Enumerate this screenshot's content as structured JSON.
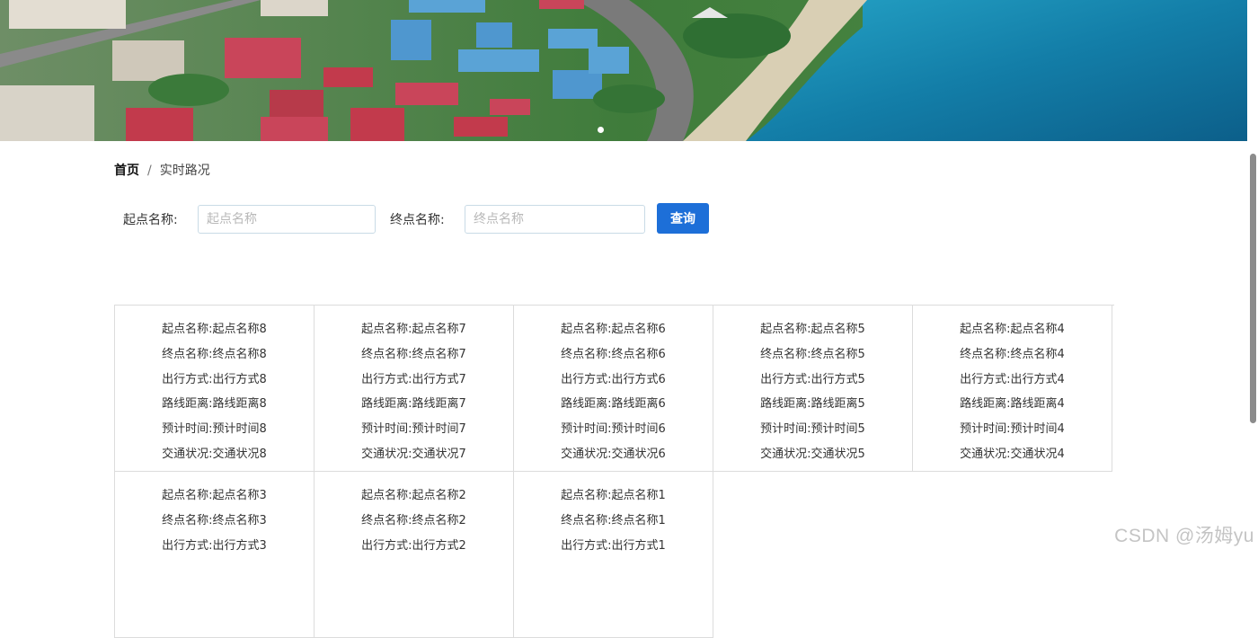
{
  "banner": {
    "image": "coastal-city-aerial",
    "dots": 1
  },
  "breadcrumb": {
    "home": "首页",
    "separator": "/",
    "current": "实时路况"
  },
  "search": {
    "start_label": "起点名称:",
    "start_placeholder": "起点名称",
    "start_value": "",
    "end_label": "终点名称:",
    "end_placeholder": "终点名称",
    "end_value": "",
    "query_label": "查询"
  },
  "cards": [
    {
      "lines": [
        "起点名称:起点名称8",
        "终点名称:终点名称8",
        "出行方式:出行方式8",
        "路线距离:路线距离8",
        "预计时间:预计时间8",
        "交通状况:交通状况8"
      ]
    },
    {
      "lines": [
        "起点名称:起点名称7",
        "终点名称:终点名称7",
        "出行方式:出行方式7",
        "路线距离:路线距离7",
        "预计时间:预计时间7",
        "交通状况:交通状况7"
      ]
    },
    {
      "lines": [
        "起点名称:起点名称6",
        "终点名称:终点名称6",
        "出行方式:出行方式6",
        "路线距离:路线距离6",
        "预计时间:预计时间6",
        "交通状况:交通状况6"
      ]
    },
    {
      "lines": [
        "起点名称:起点名称5",
        "终点名称:终点名称5",
        "出行方式:出行方式5",
        "路线距离:路线距离5",
        "预计时间:预计时间5",
        "交通状况:交通状况5"
      ]
    },
    {
      "lines": [
        "起点名称:起点名称4",
        "终点名称:终点名称4",
        "出行方式:出行方式4",
        "路线距离:路线距离4",
        "预计时间:预计时间4",
        "交通状况:交通状况4"
      ]
    },
    {
      "lines": [
        "起点名称:起点名称3",
        "终点名称:终点名称3",
        "出行方式:出行方式3"
      ]
    },
    {
      "lines": [
        "起点名称:起点名称2",
        "终点名称:终点名称2",
        "出行方式:出行方式2"
      ]
    },
    {
      "lines": [
        "起点名称:起点名称1",
        "终点名称:终点名称1",
        "出行方式:出行方式1"
      ]
    }
  ],
  "watermark": "CSDN @汤姆yu",
  "colors": {
    "primary": "#1d6fd8",
    "border": "#dcdcdc",
    "input_border": "#c9dbe6",
    "sea": "#1a7fa6"
  }
}
